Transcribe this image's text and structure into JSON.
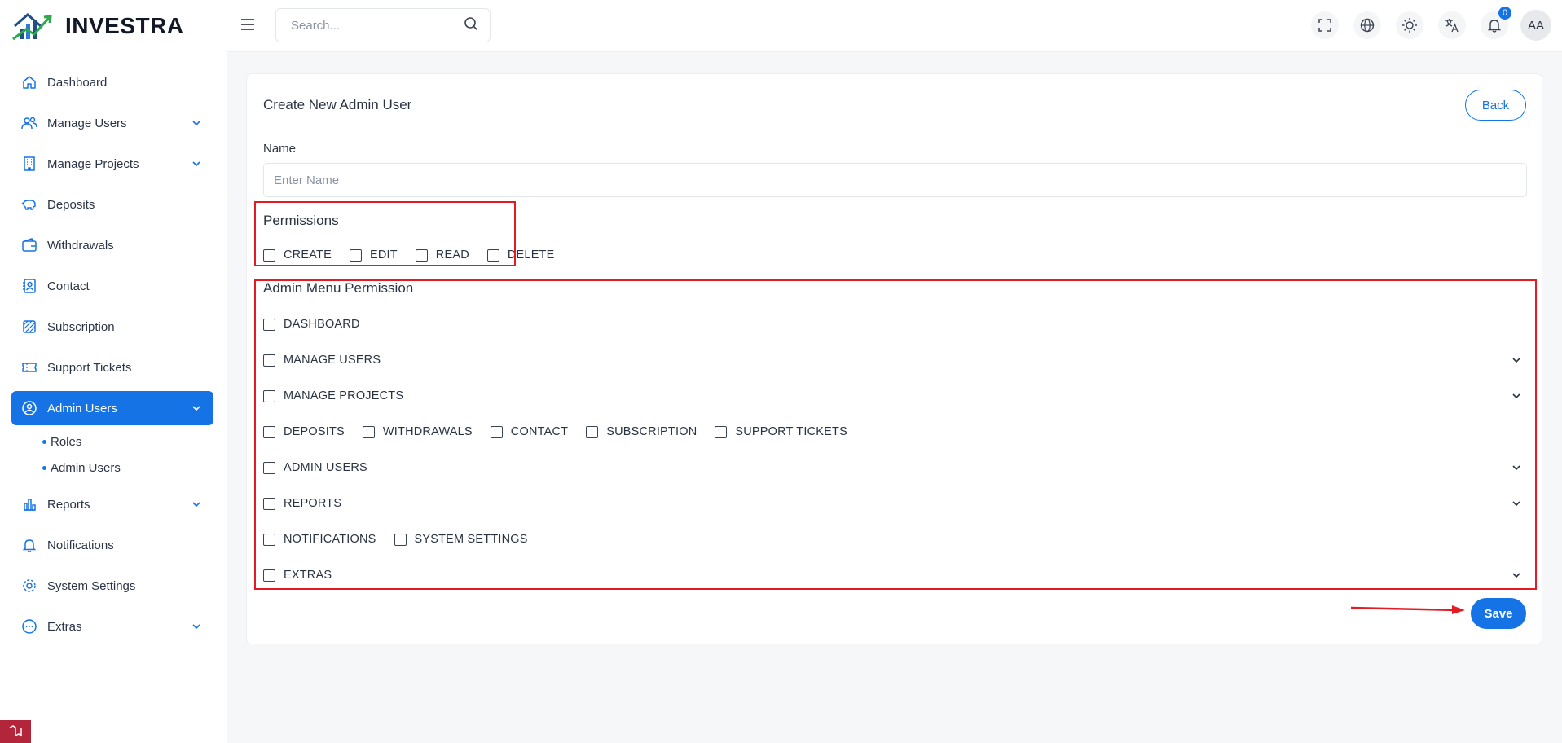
{
  "brand": {
    "name": "INVESTRA"
  },
  "colors": {
    "accent": "#1673e6",
    "highlight": "#e41b23",
    "text": "#2a3342"
  },
  "sidebar": {
    "items": [
      {
        "label": "Dashboard",
        "icon": "home-icon"
      },
      {
        "label": "Manage Users",
        "icon": "users-icon",
        "has_children": true
      },
      {
        "label": "Manage Projects",
        "icon": "building-icon",
        "has_children": true
      },
      {
        "label": "Deposits",
        "icon": "piggy-bank-icon"
      },
      {
        "label": "Withdrawals",
        "icon": "wallet-icon"
      },
      {
        "label": "Contact",
        "icon": "contact-icon"
      },
      {
        "label": "Subscription",
        "icon": "subscription-icon"
      },
      {
        "label": "Support Tickets",
        "icon": "ticket-icon"
      },
      {
        "label": "Admin Users",
        "icon": "user-cog-icon",
        "has_children": true,
        "active": true
      },
      {
        "label": "Reports",
        "icon": "bar-chart-icon",
        "has_children": true
      },
      {
        "label": "Notifications",
        "icon": "bell-icon"
      },
      {
        "label": "System Settings",
        "icon": "gear-icon"
      },
      {
        "label": "Extras",
        "icon": "dots-circle-icon",
        "has_children": true
      }
    ],
    "admin_children": [
      "Roles",
      "Admin Users"
    ]
  },
  "header": {
    "search_placeholder": "Search...",
    "notification_count": "0",
    "avatar_initials": "AA"
  },
  "form": {
    "title": "Create New Admin User",
    "back_label": "Back",
    "name_label": "Name",
    "name_placeholder": "Enter Name",
    "name_value": "",
    "permissions_title": "Permissions",
    "permissions": [
      "CREATE",
      "EDIT",
      "READ",
      "DELETE"
    ],
    "menu_title": "Admin Menu Permission",
    "menu_rows": [
      {
        "items": [
          "DASHBOARD"
        ],
        "expandable": false
      },
      {
        "items": [
          "MANAGE USERS"
        ],
        "expandable": true
      },
      {
        "items": [
          "MANAGE PROJECTS"
        ],
        "expandable": true
      },
      {
        "items": [
          "DEPOSITS",
          "WITHDRAWALS",
          "CONTACT",
          "SUBSCRIPTION",
          "SUPPORT TICKETS"
        ],
        "expandable": false
      },
      {
        "items": [
          "ADMIN USERS"
        ],
        "expandable": true
      },
      {
        "items": [
          "REPORTS"
        ],
        "expandable": true
      },
      {
        "items": [
          "NOTIFICATIONS",
          "SYSTEM SETTINGS"
        ],
        "expandable": false
      },
      {
        "items": [
          "EXTRAS"
        ],
        "expandable": true
      }
    ],
    "save_label": "Save"
  }
}
